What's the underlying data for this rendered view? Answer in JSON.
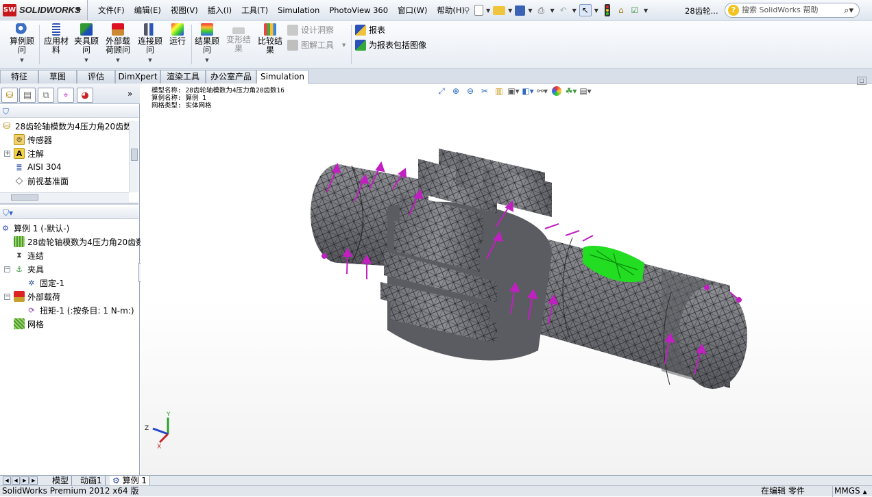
{
  "app": {
    "logo_text": "SOLIDWORKS",
    "logo_badge": "SW",
    "window_title": "28齿轮..."
  },
  "menu": {
    "items": [
      "文件(F)",
      "编辑(E)",
      "视图(V)",
      "插入(I)",
      "工具(T)",
      "Simulation",
      "PhotoView 360",
      "窗口(W)",
      "帮助(H)"
    ]
  },
  "search": {
    "placeholder": "搜索 SolidWorks 帮助"
  },
  "ribbon": {
    "buttons": [
      {
        "label": "算例顾\n问",
        "enabled": true
      },
      {
        "label": "应用材\n料",
        "enabled": true
      },
      {
        "label": "夹具顾\n问",
        "enabled": true
      },
      {
        "label": "外部载\n荷顾问",
        "enabled": true
      },
      {
        "label": "连接顾\n问",
        "enabled": true
      },
      {
        "label": "运行",
        "enabled": true
      },
      {
        "label": "结果顾\n问",
        "enabled": true
      },
      {
        "label": "变形结\n果",
        "enabled": false
      },
      {
        "label": "比较结\n果",
        "enabled": true
      }
    ],
    "design_insight": "设计洞察",
    "plot_tools": "图解工具",
    "report": "报表",
    "include_image": "为报表包括图像"
  },
  "tabs": [
    "特征",
    "草图",
    "评估",
    "DimXpert",
    "渲染工具",
    "办公室产品",
    "Simulation"
  ],
  "active_tab": "Simulation",
  "feature_tree": {
    "root": "28齿轮轴模数为4压力角20齿数",
    "items": [
      "传感器",
      "注解",
      "AISI 304",
      "前视基准面"
    ]
  },
  "study_tree": {
    "study": "算例 1 (-默认-)",
    "part": "28齿轮轴模数为4压力角20齿数",
    "connections": "连结",
    "fixtures": "夹具",
    "fixed": "固定-1",
    "external_loads": "外部载荷",
    "torque": "扭矩-1 (:按条目: 1 N-m:)",
    "mesh": "网格"
  },
  "model_info": {
    "line1": "模型名称: 28齿轮轴模数为4压力角20齿数16",
    "line2": "算例名称: 算例 1",
    "line3": "网格类型: 实体网格"
  },
  "triad": {
    "x": "X",
    "y": "Y",
    "z": "Z"
  },
  "bottom_tabs": [
    "模型",
    "动画1",
    "算例 1"
  ],
  "status": {
    "left": "SolidWorks Premium 2012 x64 版",
    "editing": "在编辑 零件",
    "units": "MMGS"
  },
  "colors": {
    "load_arrow": "#c21fc2",
    "fixture": "#22dd22",
    "mesh_face": "#7b7c80",
    "sw_red": "#c8161d"
  }
}
